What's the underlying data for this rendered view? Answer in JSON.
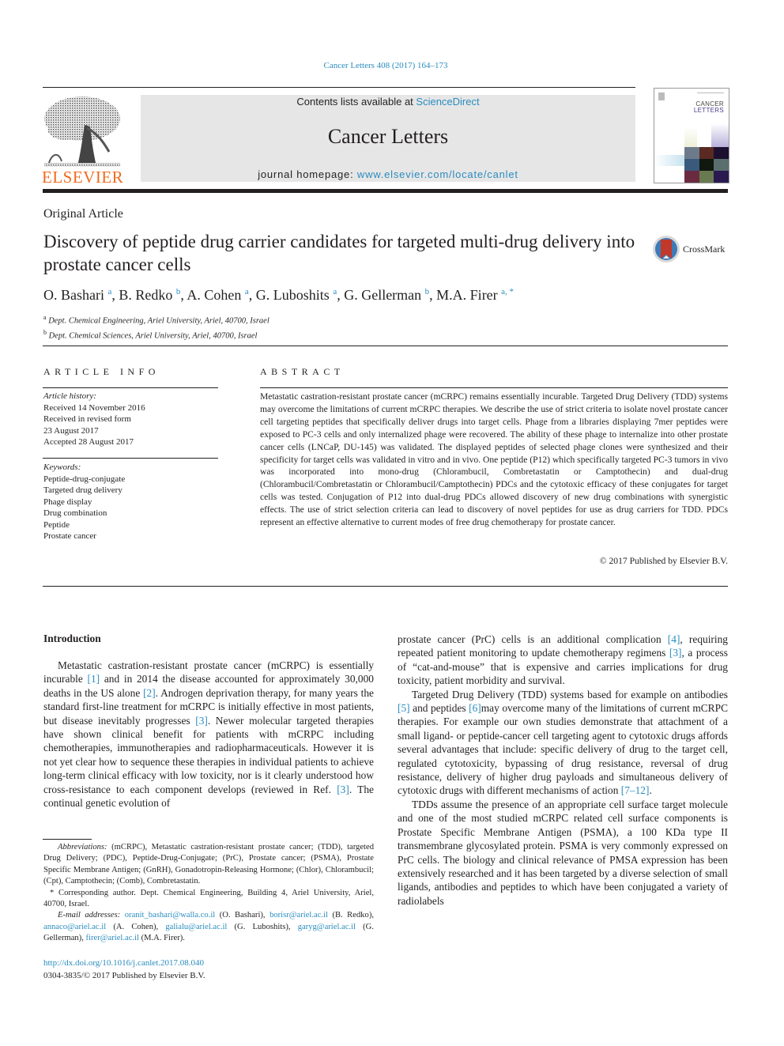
{
  "header": {
    "citation": "Cancer Letters 408 (2017) 164–173",
    "contents_prefix": "Contents lists available at ",
    "contents_link": "ScienceDirect",
    "journal_title": "Cancer Letters",
    "homepage_prefix": "journal homepage: ",
    "homepage_link": "www.elsevier.com/locate/canlet",
    "publisher_logo_text": "ELSEVIER",
    "cover_title_line1": "CANCER",
    "cover_title_line2": "LETTERS",
    "crossmark_label": "CrossMark"
  },
  "article": {
    "type": "Original Article",
    "title": "Discovery of peptide drug carrier candidates for targeted multi-drug delivery into prostate cancer cells",
    "authors": [
      {
        "name": "O. Bashari",
        "sup": "a"
      },
      {
        "name": "B. Redko",
        "sup": "b"
      },
      {
        "name": "A. Cohen",
        "sup": "a"
      },
      {
        "name": "G. Luboshits",
        "sup": "a"
      },
      {
        "name": "G. Gellerman",
        "sup": "b"
      },
      {
        "name": "M.A. Firer",
        "sup": "a, *"
      }
    ],
    "affiliations": [
      {
        "sup": "a",
        "text": "Dept. Chemical Engineering, Ariel University, Ariel, 40700, Israel"
      },
      {
        "sup": "b",
        "text": "Dept. Chemical Sciences, Ariel University, Ariel, 40700, Israel"
      }
    ]
  },
  "article_info": {
    "heading": "ARTICLE INFO",
    "history_label": "Article history:",
    "history": [
      "Received 14 November 2016",
      "Received in revised form",
      "23 August 2017",
      "Accepted 28 August 2017"
    ],
    "keywords_label": "Keywords:",
    "keywords": [
      "Peptide-drug-conjugate",
      "Targeted drug delivery",
      "Phage display",
      "Drug combination",
      "Peptide",
      "Prostate cancer"
    ]
  },
  "abstract": {
    "heading": "ABSTRACT",
    "text": "Metastatic castration-resistant prostate cancer (mCRPC) remains essentially incurable. Targeted Drug Delivery (TDD) systems may overcome the limitations of current mCRPC therapies. We describe the use of strict criteria to isolate novel prostate cancer cell targeting peptides that specifically deliver drugs into target cells. Phage from a libraries displaying 7mer peptides were exposed to PC-3 cells and only internalized phage were recovered. The ability of these phage to internalize into other prostate cancer cells (LNCaP, DU-145) was validated. The displayed peptides of selected phage clones were synthesized and their specificity for target cells was validated in vitro and in vivo. One peptide (P12) which specifically targeted PC-3 tumors in vivo was incorporated into mono-drug (Chlorambucil, Combretastatin or Camptothecin) and dual-drug (Chlorambucil/Combretastatin or Chlorambucil/Camptothecin) PDCs and the cytotoxic efficacy of these conjugates for target cells was tested. Conjugation of P12 into dual-drug PDCs allowed discovery of new drug combinations with synergistic effects. The use of strict selection criteria can lead to discovery of novel peptides for use as drug carriers for TDD. PDCs represent an effective alternative to current modes of free drug chemotherapy for prostate cancer.",
    "copyright": "© 2017 Published by Elsevier B.V."
  },
  "introduction": {
    "heading": "Introduction",
    "col1": [
      {
        "t": "Metastatic castration-resistant prostate cancer (mCRPC) is essentially incurable "
      },
      {
        "ref": "[1]"
      },
      {
        "t": " and in 2014 the disease accounted for approximately 30,000 deaths in the US alone "
      },
      {
        "ref": "[2]"
      },
      {
        "t": ". Androgen deprivation therapy, for many years the standard first-line treatment for mCRPC is initially effective in most patients, but disease inevitably progresses "
      },
      {
        "ref": "[3]"
      },
      {
        "t": ". Newer molecular targeted therapies have shown clinical benefit for patients with mCRPC including chemotherapies, immunotherapies and radiopharmaceuticals. However it is not yet clear how to sequence these therapies in individual patients to achieve long-term clinical efficacy with low toxicity, nor is it clearly understood how cross-resistance to each component develops (reviewed in Ref. "
      },
      {
        "ref": "[3]"
      },
      {
        "t": ". The continual genetic evolution of"
      }
    ],
    "col2_p1": [
      {
        "t": "prostate cancer (PrC) cells is an additional complication "
      },
      {
        "ref": "[4]"
      },
      {
        "t": ", requiring repeated patient monitoring to update chemotherapy regimens "
      },
      {
        "ref": "[3]"
      },
      {
        "t": ", a process of “cat-and-mouse” that is expensive and carries implications for drug toxicity, patient morbidity and survival."
      }
    ],
    "col2_p2": [
      {
        "t": "Targeted Drug Delivery (TDD) systems based for example on antibodies "
      },
      {
        "ref": "[5]"
      },
      {
        "t": " and peptides "
      },
      {
        "ref": "[6]"
      },
      {
        "t": "may overcome many of the limitations of current mCRPC therapies. For example our own studies demonstrate that attachment of a small ligand- or peptide-cancer cell targeting agent to cytotoxic drugs affords several advantages that include: specific delivery of drug to the target cell, regulated cytotoxicity, bypassing of drug resistance, reversal of drug resistance, delivery of higher drug payloads and simultaneous delivery of cytotoxic drugs with different mechanisms of action "
      },
      {
        "ref": "[7‒12]"
      },
      {
        "t": "."
      }
    ],
    "col2_p3": "TDDs assume the presence of an appropriate cell surface target molecule and one of the most studied mCRPC related cell surface components is Prostate Specific Membrane Antigen (PSMA), a 100 KDa type II transmembrane glycosylated protein. PSMA is very commonly expressed on PrC cells. The biology and clinical relevance of PMSA expression has been extensively researched and it has been targeted by a diverse selection of small ligands, antibodies and peptides to which have been conjugated a variety of radiolabels"
  },
  "footnotes": {
    "abbrev_label": "Abbreviations:",
    "abbrev_text": " (mCRPC), Metastatic castration-resistant prostate cancer; (TDD), targeted Drug Delivery; (PDC), Peptide-Drug-Conjugate; (PrC), Prostate cancer; (PSMA), Prostate Specific Membrane Antigen; (GnRH), Gonadotropin-Releasing Hormone; (Chlor), Chlorambucil; (Cpt), Camptothecin; (Comb), Combretastatin.",
    "corresponding": "* Corresponding author. Dept. Chemical Engineering, Building 4, Ariel University, Ariel, 40700, Israel.",
    "email_label": "E-mail addresses:",
    "emails": [
      {
        "email": "oranit_bashari@walla.co.il",
        "who": " (O. Bashari), "
      },
      {
        "email": "borisr@ariel.ac.il",
        "who": " (B. Redko), "
      },
      {
        "email": "annaco@ariel.ac.il",
        "who": " (A. Cohen), "
      },
      {
        "email": "galialu@ariel.ac.il",
        "who": " (G. Luboshits), "
      },
      {
        "email": "garyg@ariel.ac.il",
        "who": " (G. Gellerman), "
      },
      {
        "email": "firer@ariel.ac.il",
        "who": " (M.A. Firer)."
      }
    ],
    "doi": "http://dx.doi.org/10.1016/j.canlet.2017.08.040",
    "issn": "0304-3835/© 2017 Published by Elsevier B.V."
  },
  "colors": {
    "link": "#2a8cbf",
    "elsevier_orange": "#f06b1e",
    "header_box": "#e6e6e6",
    "crossmark_red": "#c0392b"
  }
}
